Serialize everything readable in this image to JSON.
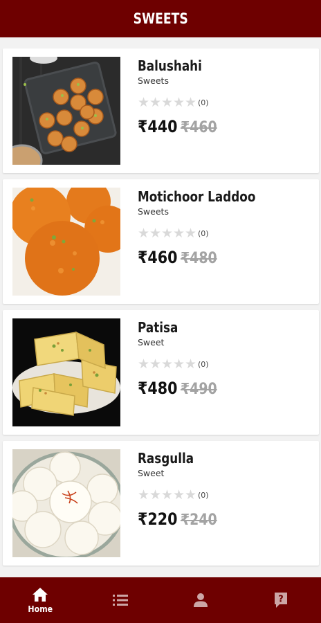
{
  "header": {
    "title": "SWEETS"
  },
  "products": [
    {
      "name": "Balushahi",
      "category": "Sweets",
      "rating_count": "(0)",
      "price": "₹440",
      "old_price": "₹460",
      "image": "balushahi-plate-image"
    },
    {
      "name": "Motichoor Laddoo",
      "category": "Sweets",
      "rating_count": "(0)",
      "price": "₹460",
      "old_price": "₹480",
      "image": "laddoo-image"
    },
    {
      "name": "Patisa",
      "category": "Sweet",
      "rating_count": "(0)",
      "price": "₹480",
      "old_price": "₹490",
      "image": "patisa-image"
    },
    {
      "name": "Rasgulla",
      "category": "Sweet",
      "rating_count": "(0)",
      "price": "₹220",
      "old_price": "₹240",
      "image": "rasgulla-bowl-image"
    }
  ],
  "stars": "★",
  "nav": {
    "items": [
      {
        "label": "Home",
        "icon": "home-icon",
        "active": true
      },
      {
        "label": "",
        "icon": "list-icon",
        "active": false
      },
      {
        "label": "",
        "icon": "person-icon",
        "active": false
      },
      {
        "label": "",
        "icon": "help-icon",
        "active": false
      }
    ]
  },
  "colors": {
    "primary": "#6e0000",
    "star_empty": "#d9d9d9",
    "old_price": "#a3a3a3"
  }
}
